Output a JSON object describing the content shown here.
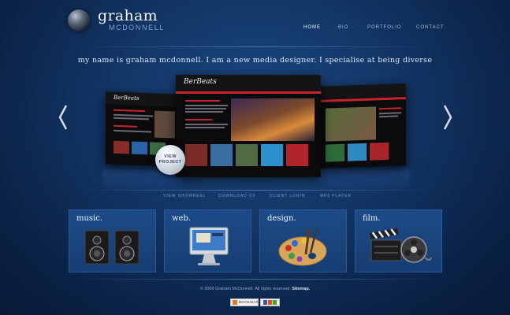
{
  "logo": {
    "name": "graham",
    "sub": "MCDONNELL"
  },
  "nav": [
    {
      "label": "HOME",
      "active": true
    },
    {
      "label": "BIO",
      "active": false
    },
    {
      "label": "PORTFOLIO",
      "active": false
    },
    {
      "label": "CONTACT",
      "active": false
    }
  ],
  "tagline": "my name is graham mcdonnell.   I am a new media designer.   I specialise at being diverse",
  "carousel": {
    "view_button": [
      "VIEW",
      "PROJECT"
    ],
    "shot_brand": "BerBeats"
  },
  "sublinks": [
    "VIEW SHOWREEL",
    "DOWNLOAD CV",
    "CLIENT LOGIN",
    "MP3 PLAYER"
  ],
  "cards": [
    {
      "title": "music."
    },
    {
      "title": "web."
    },
    {
      "title": "design."
    },
    {
      "title": "film."
    }
  ],
  "footer": {
    "text": "© 2009 Graham McDonnell. All rights reserved.",
    "sitemap": "Sitemap."
  },
  "badges": [
    {
      "label": "BOOKMARK"
    },
    {
      "label": ""
    }
  ],
  "colors": {
    "accent_red": "#c0262b",
    "bg": "#123666",
    "card": "#1d4b87"
  }
}
